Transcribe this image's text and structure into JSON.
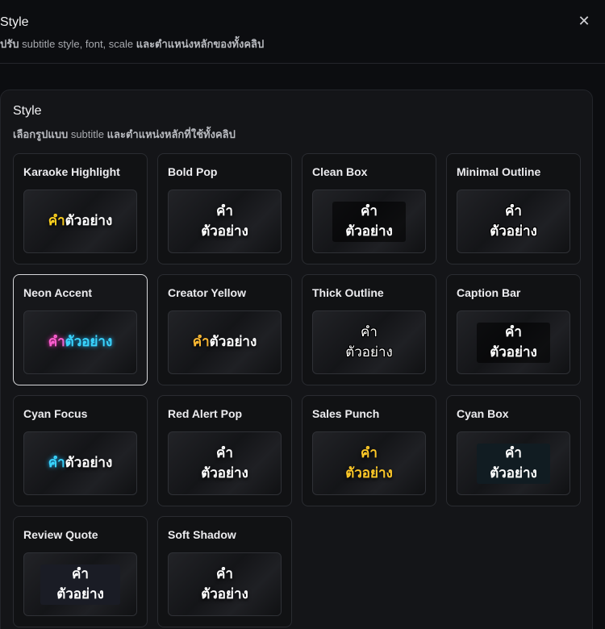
{
  "header": {
    "title": "Style",
    "subtitle_bold1": "ปรับ",
    "subtitle_mid": " subtitle style, font, scale ",
    "subtitle_bold2": "และตำแหน่งหลักของทั้งคลิป",
    "close_icon": "close-icon"
  },
  "panel": {
    "title": "Style",
    "subtitle_bold1": "เลือกรูปแบบ",
    "subtitle_mid": " subtitle ",
    "subtitle_bold2": "และตำแหน่งหลักที่ใช้ทั้งคลิป"
  },
  "preview_text": {
    "word1": "คำ",
    "word2": "ตัวอย่าง"
  },
  "styles": [
    {
      "name": "Karaoke Highlight",
      "selected": true
    },
    {
      "name": "Bold Pop",
      "selected": false
    },
    {
      "name": "Clean Box",
      "selected": false
    },
    {
      "name": "Minimal Outline",
      "selected": false
    },
    {
      "name": "Neon Accent",
      "selected": true
    },
    {
      "name": "Creator Yellow",
      "selected": false
    },
    {
      "name": "Thick Outline",
      "selected": false
    },
    {
      "name": "Caption Bar",
      "selected": false
    },
    {
      "name": "Cyan Focus",
      "selected": false
    },
    {
      "name": "Red Alert Pop",
      "selected": false
    },
    {
      "name": "Sales Punch",
      "selected": false
    },
    {
      "name": "Cyan Box",
      "selected": false
    },
    {
      "name": "Review Quote",
      "selected": false
    },
    {
      "name": "Soft Shadow",
      "selected": false
    }
  ],
  "colors": {
    "karaoke_highlight": "#ffd21f",
    "neon_pink": "#ff5fd0",
    "neon_cyan": "#3ad6ff",
    "creator_yellow": "#ffbb33",
    "sales_gold": "#ffc928"
  }
}
